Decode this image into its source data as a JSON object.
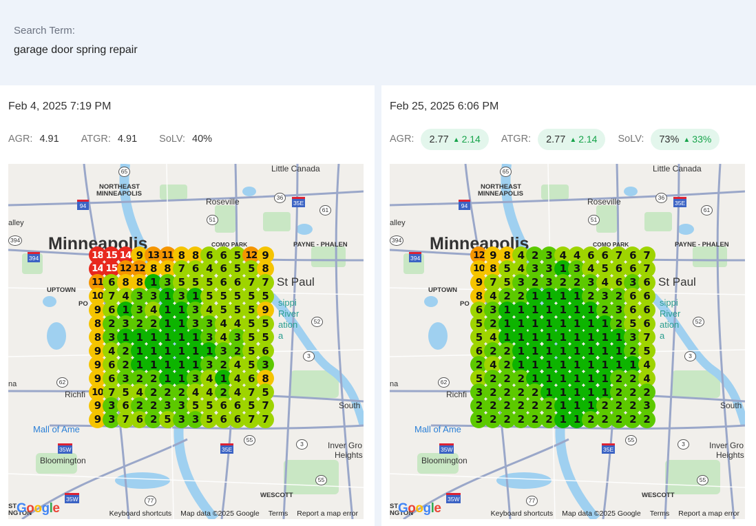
{
  "header": {
    "search_label": "Search Term:",
    "search_term": "garage door spring repair"
  },
  "panels": [
    {
      "date": "Feb 4, 2025 7:19 PM",
      "agr_label": "AGR:",
      "agr": "4.91",
      "agr_delta": "",
      "atgr_label": "ATGR:",
      "atgr": "4.91",
      "atgr_delta": "",
      "solv_label": "SoLV:",
      "solv": "40%",
      "solv_delta": "",
      "grid": [
        [
          18,
          15,
          14,
          9,
          13,
          11,
          8,
          8,
          6,
          6,
          5,
          12,
          9
        ],
        [
          14,
          15,
          12,
          12,
          8,
          8,
          7,
          6,
          4,
          6,
          5,
          5,
          8
        ],
        [
          11,
          6,
          8,
          8,
          1,
          3,
          5,
          5,
          5,
          6,
          6,
          7,
          7
        ],
        [
          10,
          7,
          4,
          3,
          3,
          1,
          3,
          1,
          5,
          5,
          5,
          5,
          5
        ],
        [
          9,
          6,
          1,
          3,
          4,
          1,
          1,
          3,
          4,
          5,
          5,
          5,
          9
        ],
        [
          8,
          2,
          3,
          2,
          2,
          1,
          1,
          3,
          3,
          4,
          4,
          5,
          5
        ],
        [
          8,
          3,
          1,
          1,
          1,
          1,
          1,
          1,
          3,
          4,
          3,
          5,
          5
        ],
        [
          9,
          4,
          2,
          1,
          1,
          1,
          1,
          1,
          1,
          3,
          2,
          5,
          6
        ],
        [
          9,
          6,
          2,
          1,
          1,
          1,
          1,
          1,
          3,
          2,
          4,
          5,
          3
        ],
        [
          9,
          6,
          3,
          2,
          2,
          1,
          1,
          3,
          4,
          1,
          4,
          6,
          8
        ],
        [
          10,
          7,
          5,
          4,
          2,
          2,
          2,
          4,
          4,
          2,
          4,
          7,
          5
        ],
        [
          9,
          3,
          6,
          2,
          2,
          3,
          3,
          5,
          5,
          6,
          6,
          5,
          7
        ],
        [
          9,
          3,
          7,
          6,
          2,
          5,
          3,
          3,
          5,
          6,
          6,
          7,
          7
        ]
      ]
    },
    {
      "date": "Feb 25, 2025 6:06 PM",
      "agr_label": "AGR:",
      "agr": "2.77",
      "agr_delta": "2.14",
      "atgr_label": "ATGR:",
      "atgr": "2.77",
      "atgr_delta": "2.14",
      "solv_label": "SoLV:",
      "solv": "73%",
      "solv_delta": "33%",
      "grid": [
        [
          12,
          9,
          8,
          4,
          2,
          3,
          4,
          4,
          6,
          6,
          7,
          6,
          7
        ],
        [
          10,
          8,
          5,
          4,
          3,
          3,
          1,
          3,
          4,
          5,
          6,
          6,
          7
        ],
        [
          9,
          7,
          5,
          3,
          2,
          3,
          2,
          2,
          3,
          4,
          6,
          3,
          6
        ],
        [
          8,
          4,
          2,
          2,
          1,
          1,
          1,
          1,
          2,
          3,
          2,
          6,
          6
        ],
        [
          6,
          3,
          1,
          1,
          1,
          1,
          1,
          1,
          1,
          2,
          3,
          6,
          6
        ],
        [
          5,
          2,
          1,
          1,
          1,
          1,
          1,
          1,
          1,
          1,
          2,
          5,
          6
        ],
        [
          5,
          4,
          1,
          1,
          1,
          1,
          1,
          1,
          1,
          1,
          1,
          3,
          7
        ],
        [
          6,
          2,
          2,
          1,
          1,
          1,
          1,
          1,
          1,
          1,
          1,
          2,
          5
        ],
        [
          2,
          4,
          2,
          1,
          1,
          1,
          1,
          1,
          1,
          1,
          1,
          1,
          4
        ],
        [
          5,
          2,
          2,
          2,
          1,
          1,
          1,
          1,
          1,
          1,
          2,
          2,
          4
        ],
        [
          3,
          2,
          2,
          2,
          2,
          1,
          1,
          1,
          1,
          1,
          2,
          2,
          2
        ],
        [
          2,
          2,
          2,
          2,
          2,
          2,
          1,
          1,
          1,
          2,
          2,
          2,
          3
        ],
        [
          3,
          2,
          2,
          2,
          2,
          2,
          1,
          1,
          2,
          2,
          2,
          2,
          2
        ]
      ]
    }
  ],
  "map": {
    "labels": {
      "little_canada": "Little Canada",
      "ne_mpls_1": "NORTHEAST",
      "ne_mpls_2": "MINNEAPOLIS",
      "roseville": "Roseville",
      "valley": "alley",
      "minneapolis": "Minneapolis",
      "como": "COMO PARK",
      "payne": "PAYNE - PHALEN",
      "uptown": "UPTOWN",
      "powderhorn": "PO",
      "st_paul": "St Paul",
      "miss1": "sippi",
      "miss2": "River",
      "miss3": "ation",
      "miss4": "a",
      "edina": "na",
      "richfield": "Richfi",
      "south": "South",
      "mall": "Mall of Ame",
      "bloomington": "Bloomington",
      "inver1": "Inver Gro",
      "inver2": "Heights",
      "wescott": "WESCOTT",
      "eagan": "ST",
      "eagan2": "NGTON"
    },
    "shields": [
      "65",
      "94",
      "35E",
      "36",
      "61",
      "51",
      "394",
      "52",
      "3",
      "62",
      "55",
      "35W",
      "35E",
      "3",
      "55",
      "77",
      "35W",
      "394"
    ],
    "footer": [
      "Keyboard shortcuts",
      "Map data ©2025 Google",
      "Terms",
      "Report a map error"
    ],
    "google": "Google"
  },
  "colors": {
    "rank1": "#0db400",
    "rank_low": "#5cc900",
    "rank_mid": "#9ed400",
    "rank_warm": "#f5c400",
    "rank_high": "#f59500",
    "rank_top": "#e8281e"
  }
}
